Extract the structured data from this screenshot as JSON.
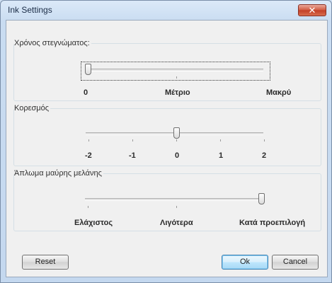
{
  "window": {
    "title": "Ink Settings",
    "close_symbol": "✕"
  },
  "drying_time": {
    "label": "Χρόνος στεγνώματος:",
    "value_index": 0,
    "tick_labels": [
      "0",
      "Μέτριο",
      "Μακρύ"
    ]
  },
  "saturation": {
    "label": "Κορεσμός",
    "value": 0,
    "tick_labels": [
      "-2",
      "-1",
      "0",
      "1",
      "2"
    ]
  },
  "black_ink_spread": {
    "label": "Άπλωμα μαύρης μελάνης",
    "value_index": 2,
    "tick_labels": [
      "Ελάχιστος",
      "Λιγότερα",
      "Κατά προεπιλογή"
    ]
  },
  "buttons": {
    "reset": "Reset",
    "ok": "Ok",
    "cancel": "Cancel"
  }
}
